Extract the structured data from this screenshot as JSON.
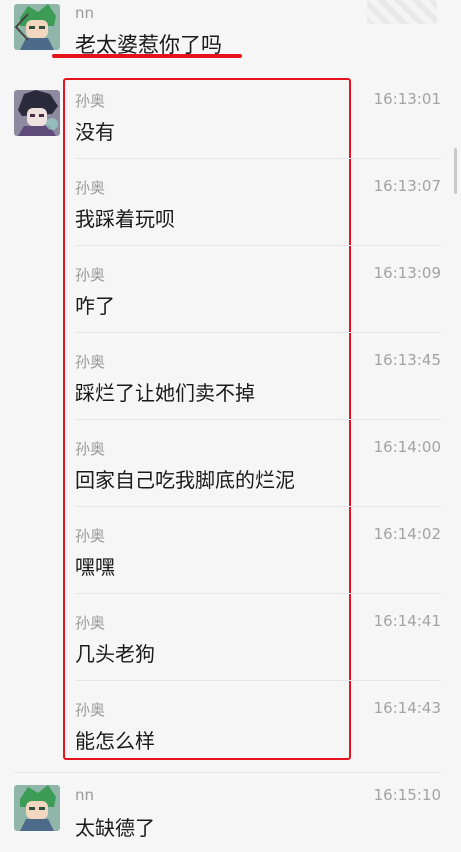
{
  "header": {
    "sender": "nn",
    "message": "老太婆惹你了吗"
  },
  "group": {
    "sender": "孙奥",
    "messages": [
      {
        "time": "16:13:01",
        "text": "没有"
      },
      {
        "time": "16:13:07",
        "text": "我踩着玩呗"
      },
      {
        "time": "16:13:09",
        "text": "咋了"
      },
      {
        "time": "16:13:45",
        "text": "踩烂了让她们卖不掉"
      },
      {
        "time": "16:14:00",
        "text": "回家自己吃我脚底的烂泥"
      },
      {
        "time": "16:14:02",
        "text": "嘿嘿"
      },
      {
        "time": "16:14:41",
        "text": "几头老狗"
      },
      {
        "time": "16:14:43",
        "text": "能怎么样"
      }
    ]
  },
  "last": {
    "sender": "nn",
    "time": "16:15:10",
    "text": "太缺德了"
  },
  "colors": {
    "highlight": "#e3141b",
    "background": "#f6f6f6"
  }
}
